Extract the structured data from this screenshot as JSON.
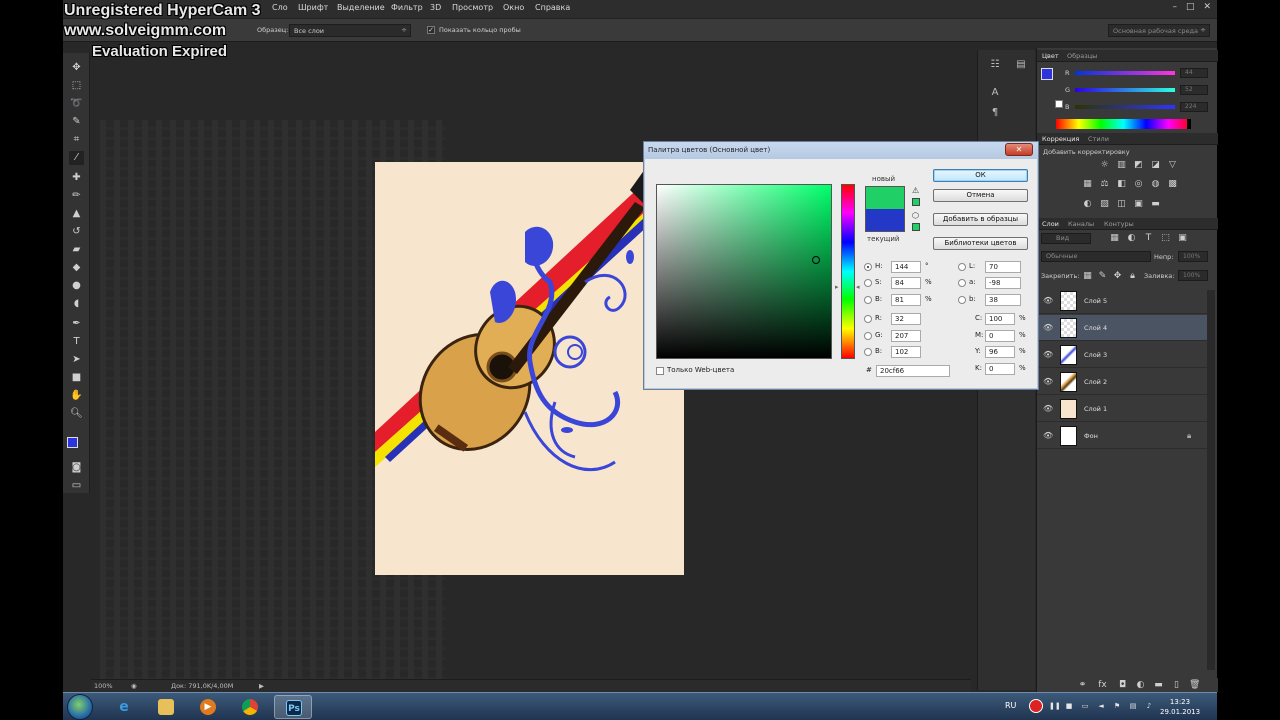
{
  "watermark": {
    "line1": "Unregistered HyperCam 3",
    "line2": "www.solveigmm.com",
    "line3": "Evaluation Expired"
  },
  "menubar": {
    "items": [
      "Шрифт",
      "Выделение",
      "Фильтр",
      "3D",
      "Просмотр",
      "Окно",
      "Справка"
    ],
    "partial_item": "Сло"
  },
  "options_bar": {
    "sample_label": "Образец:",
    "sample_value": "Все слои",
    "show_ring_label": "Показать кольцо пробы",
    "workspace": "Основная рабочая среда"
  },
  "status_bar": {
    "zoom": "100%",
    "doc_info": "Док: 791,0K/4,00M"
  },
  "color_panel": {
    "tabs": [
      "Цвет",
      "Образцы"
    ],
    "channels": [
      {
        "name": "R",
        "value": "44"
      },
      {
        "name": "G",
        "value": "52"
      },
      {
        "name": "B",
        "value": "224"
      }
    ],
    "fg_color": "#2c34e0"
  },
  "adjustments_panel": {
    "tabs": [
      "Коррекция",
      "Стили"
    ],
    "title": "Добавить корректировку"
  },
  "layers_panel": {
    "tabs": [
      "Слои",
      "Каналы",
      "Контуры"
    ],
    "kind_label": "Вид",
    "blend_mode": "Обычные",
    "opacity_label": "Непр:",
    "opacity_value": "100%",
    "lock_label": "Закрепить:",
    "fill_label": "Заливка:",
    "fill_value": "100%",
    "layers": [
      {
        "name": "Слой 5",
        "selected": false,
        "locked": false
      },
      {
        "name": "Слой 4",
        "selected": true,
        "locked": false
      },
      {
        "name": "Слой 3",
        "selected": false,
        "locked": false
      },
      {
        "name": "Слой 2",
        "selected": false,
        "locked": false
      },
      {
        "name": "Слой 1",
        "selected": false,
        "locked": false
      },
      {
        "name": "Фон",
        "selected": false,
        "locked": true
      }
    ]
  },
  "color_picker": {
    "title": "Палитра цветов (Основной цвет)",
    "close": "✕",
    "label_new": "новый",
    "label_current": "текущий",
    "new_color": "#20cf66",
    "current_color": "#2438c8",
    "buttons": {
      "ok": "ОК",
      "cancel": "Отмена",
      "add_to_swatches": "Добавить в образцы",
      "libraries": "Библиотеки цветов"
    },
    "fields_left": [
      {
        "label": "H:",
        "value": "144",
        "unit": "°",
        "radio_on": true
      },
      {
        "label": "S:",
        "value": "84",
        "unit": "%",
        "radio_on": false
      },
      {
        "label": "B:",
        "value": "81",
        "unit": "%",
        "radio_on": false
      },
      {
        "label": "R:",
        "value": "32",
        "unit": "",
        "radio_on": false
      },
      {
        "label": "G:",
        "value": "207",
        "unit": "",
        "radio_on": false
      },
      {
        "label": "B:",
        "value": "102",
        "unit": "",
        "radio_on": false
      }
    ],
    "fields_lab": [
      {
        "label": "L:",
        "value": "70"
      },
      {
        "label": "a:",
        "value": "-98"
      },
      {
        "label": "b:",
        "value": "38"
      }
    ],
    "fields_cmyk": [
      {
        "label": "C:",
        "value": "100",
        "unit": "%"
      },
      {
        "label": "M:",
        "value": "0",
        "unit": "%"
      },
      {
        "label": "Y:",
        "value": "96",
        "unit": "%"
      },
      {
        "label": "K:",
        "value": "0",
        "unit": "%"
      }
    ],
    "web_only": "Только Web-цвета",
    "hex_symbol": "#",
    "hex": "20cf66"
  },
  "taskbar": {
    "lang": "RU",
    "time": "13:23",
    "date": "29.01.2013",
    "apps": [
      "ie",
      "explorer",
      "media-player",
      "chrome",
      "photoshop"
    ],
    "ps_label": "Ps"
  }
}
